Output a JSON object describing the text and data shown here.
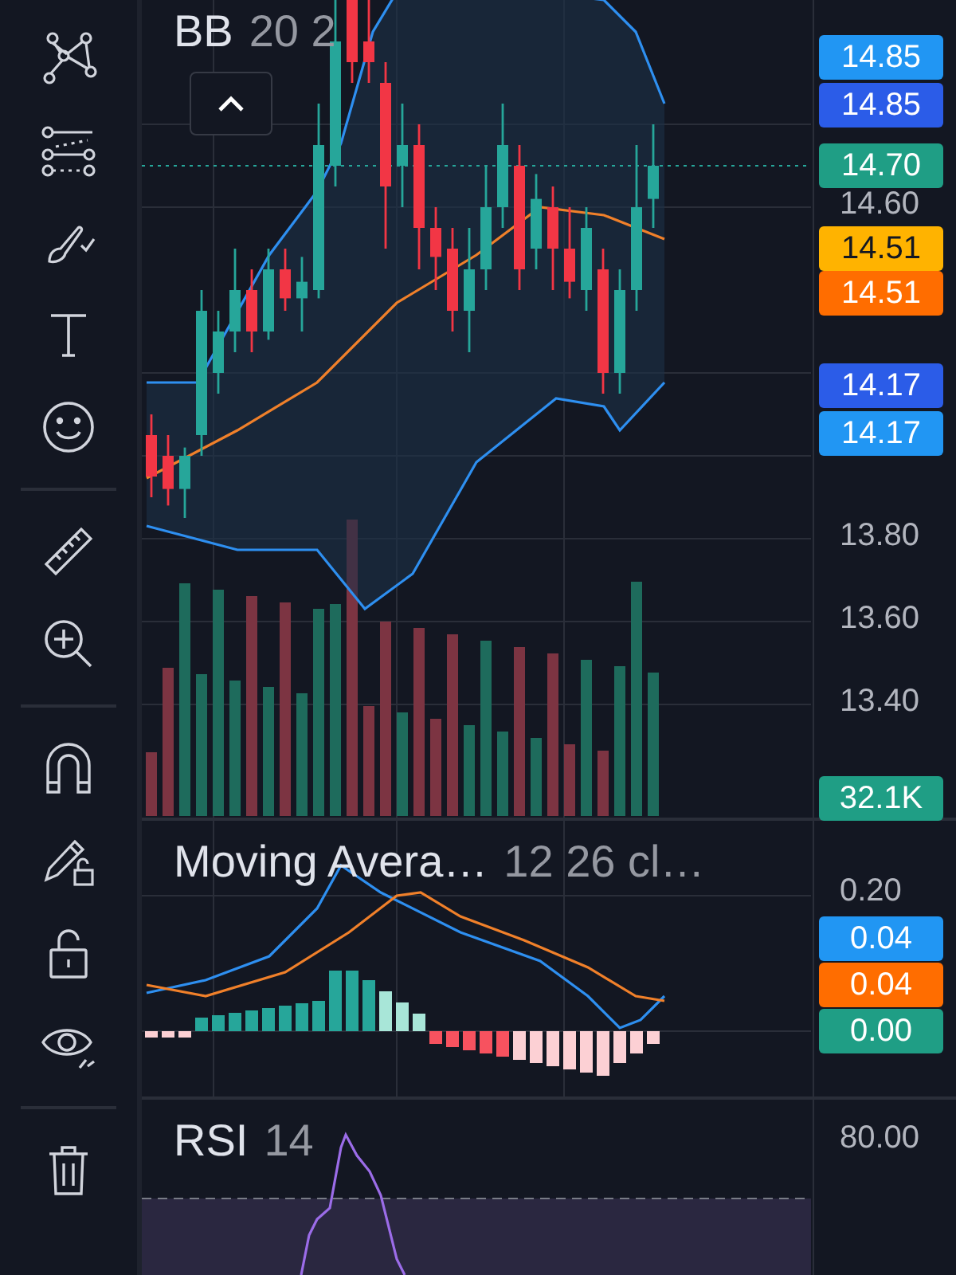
{
  "main_pane": {
    "indicator_name": "BB",
    "indicator_params": "20 2",
    "axis_labels": [
      "14.60",
      "13.80",
      "13.60",
      "13.40"
    ],
    "price_tags": [
      {
        "value": "14.85",
        "color": "#2196f3"
      },
      {
        "value": "14.85",
        "color": "#2b5ce8"
      },
      {
        "value": "14.70",
        "color": "#1f9e85"
      },
      {
        "value": "14.51",
        "color": "#ffb300"
      },
      {
        "value": "14.51",
        "color": "#ff6d00"
      },
      {
        "value": "14.17",
        "color": "#2b5ce8"
      },
      {
        "value": "14.17",
        "color": "#2196f3"
      }
    ],
    "volume_tag": {
      "value": "32.1K",
      "color": "#1f9e85"
    }
  },
  "macd_pane": {
    "name": "Moving Avera…",
    "params": "12 26 cl…",
    "axis_labels": [
      "0.20"
    ],
    "tags": [
      {
        "value": "0.04",
        "color": "#2196f3"
      },
      {
        "value": "0.04",
        "color": "#ff6d00"
      },
      {
        "value": "0.00",
        "color": "#1f9e85"
      }
    ]
  },
  "rsi_pane": {
    "name": "RSI",
    "params": "14",
    "axis_labels": [
      "80.00"
    ]
  }
}
